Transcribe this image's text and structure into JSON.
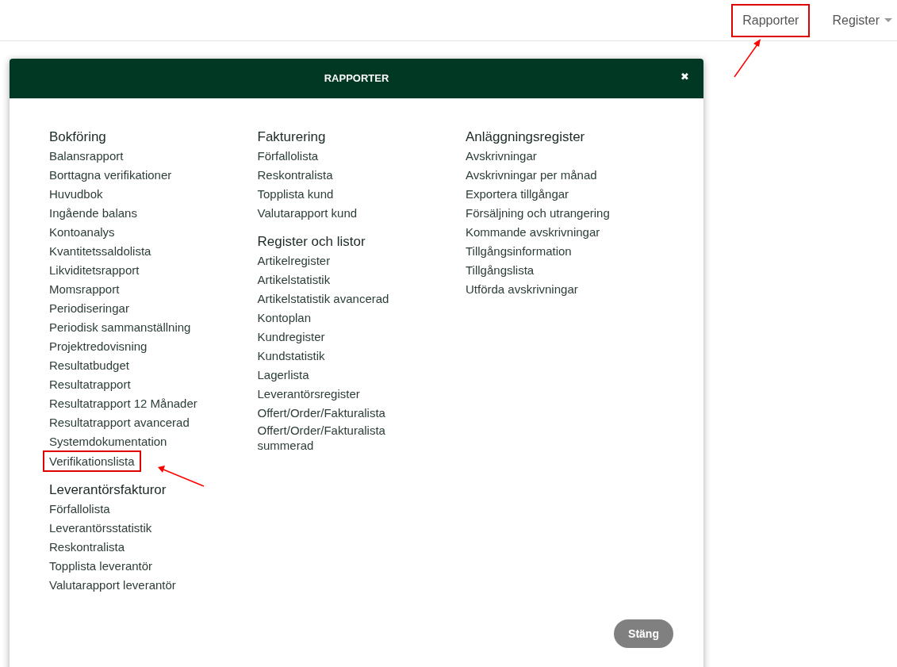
{
  "top_nav": {
    "items": [
      {
        "label": "Rapporter",
        "highlighted": true,
        "dropdown": false
      },
      {
        "label": "Register",
        "highlighted": false,
        "dropdown": true
      }
    ]
  },
  "dialog": {
    "title": "RAPPORTER",
    "close_icon": "✖",
    "columns": [
      {
        "sections": [
          {
            "heading": "Bokföring",
            "items": [
              {
                "label": "Balansrapport",
                "highlighted": false
              },
              {
                "label": "Borttagna verifikationer",
                "highlighted": false
              },
              {
                "label": "Huvudbok",
                "highlighted": false
              },
              {
                "label": "Ingående balans",
                "highlighted": false
              },
              {
                "label": "Kontoanalys",
                "highlighted": false
              },
              {
                "label": "Kvantitetssaldolista",
                "highlighted": false
              },
              {
                "label": "Likviditetsrapport",
                "highlighted": false
              },
              {
                "label": "Momsrapport",
                "highlighted": false
              },
              {
                "label": "Periodiseringar",
                "highlighted": false
              },
              {
                "label": "Periodisk sammanställning",
                "highlighted": false
              },
              {
                "label": "Projektredovisning",
                "highlighted": false
              },
              {
                "label": "Resultatbudget",
                "highlighted": false
              },
              {
                "label": "Resultatrapport",
                "highlighted": false
              },
              {
                "label": "Resultatrapport 12 Månader",
                "highlighted": false
              },
              {
                "label": "Resultatrapport avancerad",
                "highlighted": false
              },
              {
                "label": "Systemdokumentation",
                "highlighted": false
              },
              {
                "label": "Verifikationslista",
                "highlighted": true
              }
            ]
          },
          {
            "heading": "Leverantörsfakturor",
            "items": [
              {
                "label": "Förfallolista",
                "highlighted": false
              },
              {
                "label": "Leverantörsstatistik",
                "highlighted": false
              },
              {
                "label": "Reskontralista",
                "highlighted": false
              },
              {
                "label": "Topplista leverantör",
                "highlighted": false
              },
              {
                "label": "Valutarapport leverantör",
                "highlighted": false
              }
            ]
          }
        ]
      },
      {
        "sections": [
          {
            "heading": "Fakturering",
            "items": [
              {
                "label": "Förfallolista",
                "highlighted": false
              },
              {
                "label": "Reskontralista",
                "highlighted": false
              },
              {
                "label": "Topplista kund",
                "highlighted": false
              },
              {
                "label": "Valutarapport kund",
                "highlighted": false
              }
            ]
          },
          {
            "heading": "Register och listor",
            "items": [
              {
                "label": "Artikelregister",
                "highlighted": false
              },
              {
                "label": "Artikelstatistik",
                "highlighted": false
              },
              {
                "label": "Artikelstatistik avancerad",
                "highlighted": false
              },
              {
                "label": "Kontoplan",
                "highlighted": false
              },
              {
                "label": "Kundregister",
                "highlighted": false
              },
              {
                "label": "Kundstatistik",
                "highlighted": false
              },
              {
                "label": "Lagerlista",
                "highlighted": false
              },
              {
                "label": "Leverantörsregister",
                "highlighted": false
              },
              {
                "label": "Offert/Order/Fakturalista",
                "highlighted": false
              },
              {
                "label": "Offert/Order/Fakturalista summerad",
                "highlighted": false
              }
            ]
          }
        ]
      },
      {
        "sections": [
          {
            "heading": "Anläggningsregister",
            "items": [
              {
                "label": "Avskrivningar",
                "highlighted": false
              },
              {
                "label": "Avskrivningar per månad",
                "highlighted": false
              },
              {
                "label": "Exportera tillgångar",
                "highlighted": false
              },
              {
                "label": "Försäljning och utrangering",
                "highlighted": false
              },
              {
                "label": "Kommande avskrivningar",
                "highlighted": false
              },
              {
                "label": "Tillgångsinformation",
                "highlighted": false
              },
              {
                "label": "Tillgångslista",
                "highlighted": false
              },
              {
                "label": "Utförda avskrivningar",
                "highlighted": false
              }
            ]
          }
        ]
      }
    ],
    "close_button": "Stäng"
  }
}
